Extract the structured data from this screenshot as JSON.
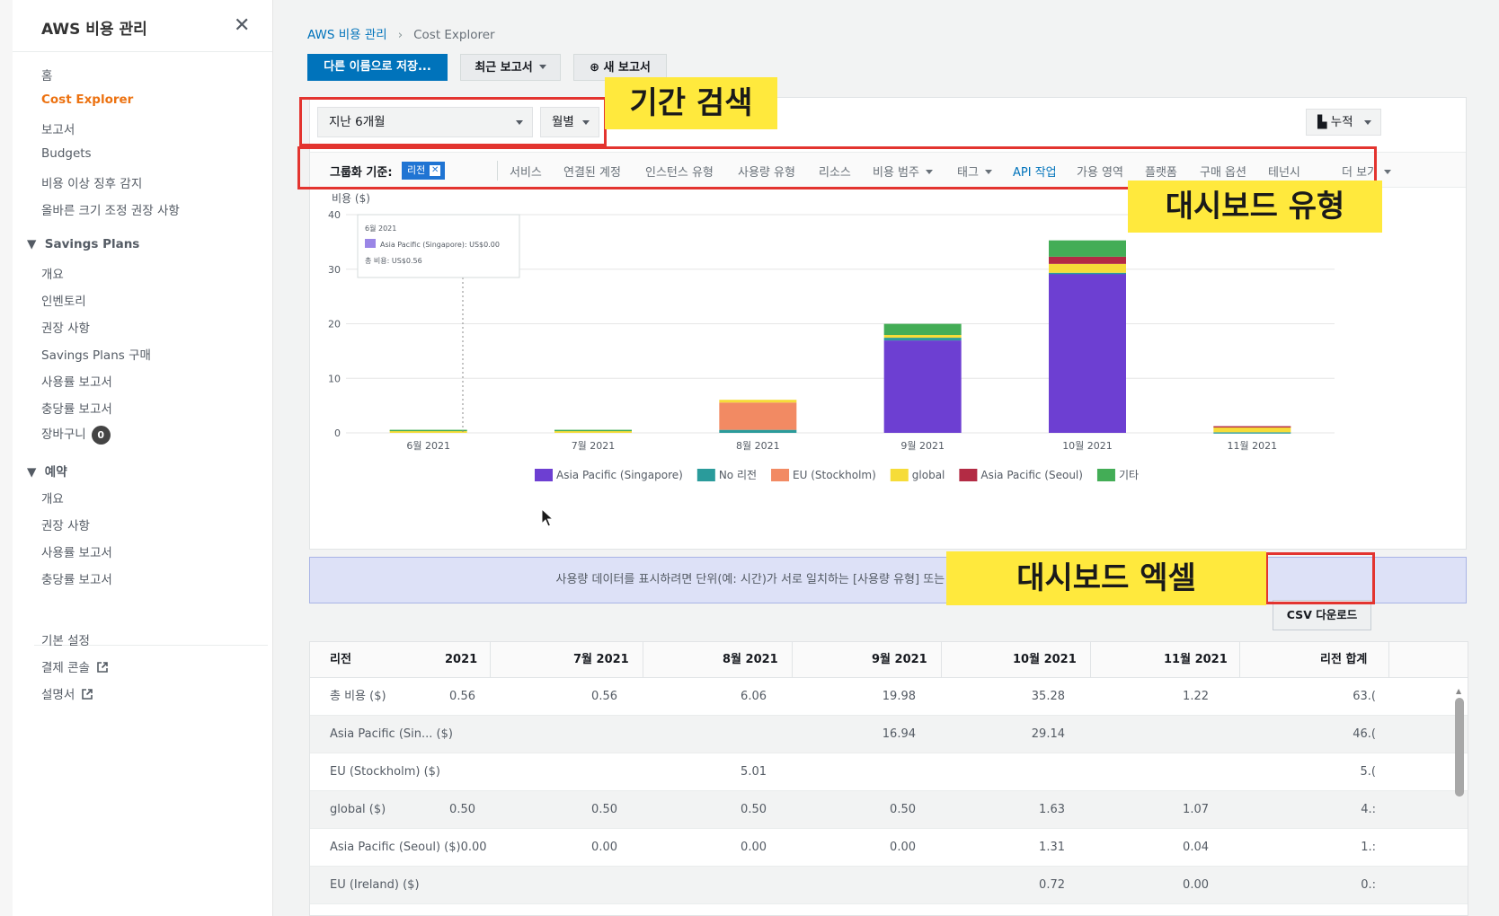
{
  "sidebar": {
    "title": "AWS 비용 관리",
    "items": [
      "홈",
      "Cost Explorer",
      "보고서",
      "Budgets",
      "비용 이상 징후 감지",
      "올바른 크기 조정 권장 사항"
    ],
    "savings_plans": {
      "title": "Savings Plans",
      "items": [
        "개요",
        "인벤토리",
        "권장 사항",
        "Savings Plans 구매",
        "사용률 보고서",
        "충당률 보고서",
        "장바구니"
      ],
      "cart_count": "0"
    },
    "reservations": {
      "title": "예약",
      "items": [
        "개요",
        "권장 사항",
        "사용률 보고서",
        "충당률 보고서"
      ]
    },
    "footer": [
      "기본 설정",
      "결제 콘솔",
      "설명서"
    ]
  },
  "breadcrumb": {
    "root": "AWS 비용 관리",
    "current": "Cost Explorer"
  },
  "toolbar": {
    "save_as": "다른 이름으로 저장...",
    "recent_reports": "최근 보고서",
    "new_report": "새 보고서"
  },
  "filters": {
    "period": "지난 6개월",
    "granularity": "월별",
    "view": "누적",
    "group_by_label": "그룹화 기준:",
    "group_chip": "리전",
    "group_options": [
      "서비스",
      "연결된 계정",
      "인스턴스 유형",
      "사용량 유형",
      "리소스",
      "비용 범주",
      "태그",
      "API 작업",
      "가용 영역",
      "플랫폼",
      "구매 옵션",
      "테넌시"
    ],
    "more": "더 보기"
  },
  "chart_data": {
    "type": "bar",
    "stacked": true,
    "ylabel": "비용 ($)",
    "ylim": [
      0,
      40
    ],
    "yticks": [
      0,
      10,
      20,
      30,
      40
    ],
    "categories": [
      "6월 2021",
      "7월 2021",
      "8월 2021",
      "9월 2021",
      "10월 2021",
      "11월 2021"
    ],
    "series": [
      {
        "name": "Asia Pacific (Singapore)",
        "color": "#6d3fd2",
        "values": [
          0,
          0,
          0,
          16.94,
          29.14,
          0
        ]
      },
      {
        "name": "No 리전",
        "color": "#2a9b9b",
        "values": [
          0,
          0,
          0.55,
          0.5,
          0.2,
          0.11
        ]
      },
      {
        "name": "EU (Stockholm)",
        "color": "#f28a63",
        "values": [
          0,
          0,
          5.01,
          0,
          0,
          0
        ]
      },
      {
        "name": "global",
        "color": "#f6dc38",
        "values": [
          0.5,
          0.5,
          0.5,
          0.5,
          1.63,
          1.07
        ]
      },
      {
        "name": "Asia Pacific (Seoul)",
        "color": "#b32b44",
        "values": [
          0,
          0,
          0,
          0,
          1.31,
          0.04
        ]
      },
      {
        "name": "기타",
        "color": "#43ad56",
        "values": [
          0.06,
          0.06,
          0,
          2.04,
          3.0,
          0
        ]
      }
    ],
    "tooltip": {
      "title": "6월 2021",
      "series_line": "Asia Pacific (Singapore): US$0.00",
      "total_line": "총 비용: US$0.56"
    }
  },
  "info_message": "사용량 데이터를 표시하려면 단위(예: 시간)가 서로 일치하는 [사용량 유형] 또는 [사용량 유형 그룹] 필터를 기준으로 필터링해야 합니다.",
  "csv_button": "CSV 다운로드",
  "table": {
    "headers": [
      "리전",
      "2021",
      "7월 2021",
      "8월 2021",
      "9월 2021",
      "10월 2021",
      "11월 2021",
      "리전 합계"
    ],
    "rows": [
      [
        "총 비용 ($)",
        "0.56",
        "0.56",
        "6.06",
        "19.98",
        "35.28",
        "1.22",
        "63.("
      ],
      [
        "Asia Pacific (Sin... ($)",
        "",
        "",
        "",
        "16.94",
        "29.14",
        "",
        "46.("
      ],
      [
        "EU (Stockholm) ($)",
        "",
        "",
        "5.01",
        "",
        "",
        "",
        "5.("
      ],
      [
        "global ($)",
        "0.50",
        "0.50",
        "0.50",
        "0.50",
        "1.63",
        "1.07",
        "4.:"
      ],
      [
        "Asia Pacific (Seoul) ($)0.00",
        "",
        "0.00",
        "0.00",
        "0.00",
        "1.31",
        "0.04",
        "1.:"
      ],
      [
        "EU (Ireland) ($)",
        "",
        "",
        "",
        "",
        "0.72",
        "0.00",
        "0.:"
      ]
    ]
  },
  "annotations": {
    "period_search": "기간 검색",
    "dashboard_type": "대시보드 유형",
    "dashboard_excel": "대시보드 엑셀"
  }
}
